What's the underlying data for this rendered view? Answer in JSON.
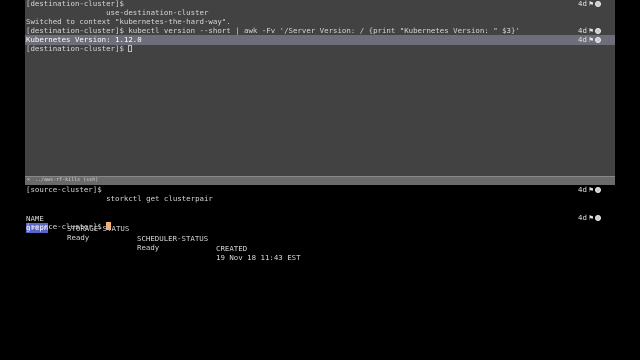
{
  "top_pane": {
    "lines": [
      "[destination-cluster]$",
      "                  use-destination-cluster",
      "Switched to context \"kubernetes-the-hard-way\".",
      "[destination-cluster]$ kubectl version --short | awk -Fv '/Server Version: / {print \"Kubernetes Version: \" $3}'",
      "Kubernetes Version: 1.12.0",
      "[destination-cluster]$ "
    ],
    "status_age": "4d",
    "flag_glyph": "⚑"
  },
  "divider": {
    "label": "../aws-rf-kills (ssh)",
    "close_glyph": "×"
  },
  "bottom_pane": {
    "prompt_line": "[source-cluster]$",
    "command_line": "                  storkctl get clusterpair",
    "table": {
      "headers": [
        "NAME",
        "STORAGE-STATUS",
        "SCHEDULER-STATUS",
        "CREATED"
      ],
      "rows": [
        [
          "grepn",
          "Ready",
          "Ready",
          "19 Nov 18 11:43 EST"
        ]
      ]
    },
    "last_prompt": "[source-cluster]$ ",
    "status_age": "4d",
    "flag_glyph": "⚑"
  },
  "colors": {
    "top_bg": "#424242",
    "highlight_row": "#6d6e7a",
    "cursor_bottom": "#f0b07a",
    "selection": "#5a63c8"
  }
}
